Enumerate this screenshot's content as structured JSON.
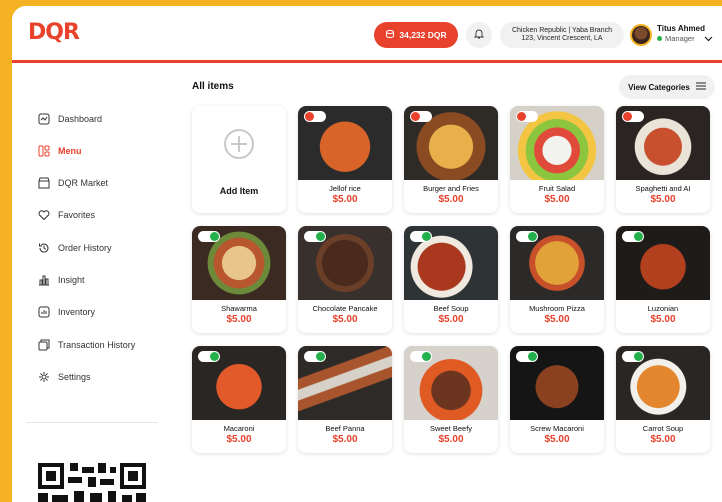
{
  "header": {
    "logo": "DQR",
    "balance": "34,232 DQR",
    "branch_line1": "Chicken Republic | Yaba Branch",
    "branch_line2": "123, Vincent Crescent, LA",
    "user_name": "Titus Ahmed",
    "user_role": "Manager"
  },
  "sidebar": {
    "items": [
      {
        "label": "Dashboard",
        "icon": "dashboard-icon",
        "active": false
      },
      {
        "label": "Menu",
        "icon": "menu-icon",
        "active": true
      },
      {
        "label": "DQR Market",
        "icon": "market-icon",
        "active": false
      },
      {
        "label": "Favorites",
        "icon": "heart-icon",
        "active": false
      },
      {
        "label": "Order History",
        "icon": "history-icon",
        "active": false
      },
      {
        "label": "Insight",
        "icon": "chart-icon",
        "active": false
      },
      {
        "label": "Inventory",
        "icon": "inventory-icon",
        "active": false
      },
      {
        "label": "Transaction History",
        "icon": "transaction-icon",
        "active": false
      },
      {
        "label": "Settings",
        "icon": "gear-icon",
        "active": false
      }
    ]
  },
  "main": {
    "title": "All items",
    "view_categories": "View Categories",
    "add_item": "Add Item",
    "items": [
      {
        "name": "Jellof rice",
        "price": "$5.00",
        "available": false
      },
      {
        "name": "Burger and Fries",
        "price": "$5.00",
        "available": false
      },
      {
        "name": "Fruit Salad",
        "price": "$5.00",
        "available": false
      },
      {
        "name": "Spaghetti and AI",
        "price": "$5.00",
        "available": false
      },
      {
        "name": "Shawarma",
        "price": "$5.00",
        "available": true
      },
      {
        "name": "Chocolate Pancake",
        "price": "$5.00",
        "available": true
      },
      {
        "name": "Beef Soup",
        "price": "$5.00",
        "available": true
      },
      {
        "name": "Mushroom Pizza",
        "price": "$5.00",
        "available": true
      },
      {
        "name": "Luzonian",
        "price": "$5.00",
        "available": true
      },
      {
        "name": "Macaroni",
        "price": "$5.00",
        "available": true
      },
      {
        "name": "Beef Panna",
        "price": "$5.00",
        "available": true
      },
      {
        "name": "Sweet Beefy",
        "price": "$5.00",
        "available": true
      },
      {
        "name": "Screw Macaroni",
        "price": "$5.00",
        "available": true
      },
      {
        "name": "Carrot Soup",
        "price": "$5.00",
        "available": true
      }
    ]
  },
  "colors": {
    "accent": "#e8412c",
    "background": "#f5b324",
    "available": "#22b14c"
  }
}
